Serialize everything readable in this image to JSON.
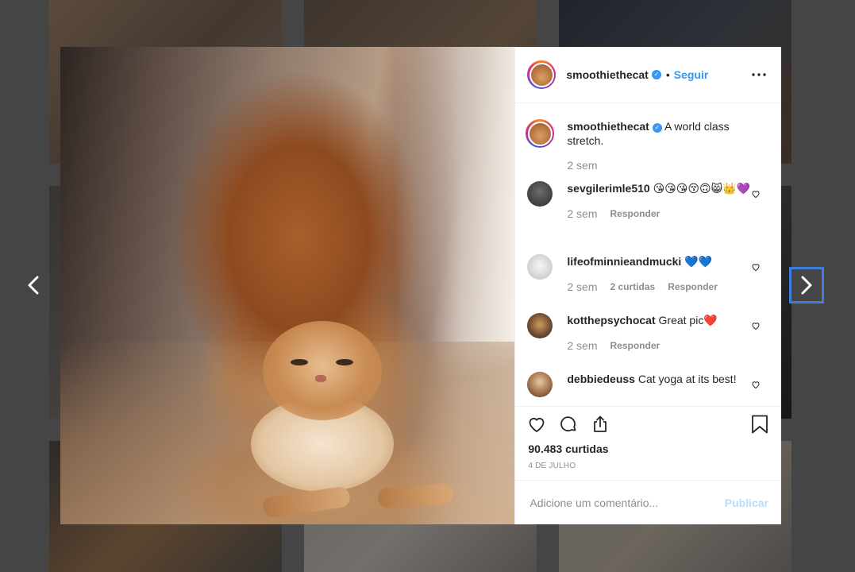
{
  "post": {
    "username": "smoothiethecat",
    "follow_label": "Seguir",
    "separator": "•",
    "caption": {
      "username": "smoothiethecat",
      "text": "A world class stretch.",
      "time": "2 sem"
    },
    "comments": [
      {
        "username": "sevgilerimle510",
        "text": "😘😘😘😚🙃😸👑💜",
        "time": "2 sem",
        "likes": "",
        "reply_label": "Responder"
      },
      {
        "username": "lifeofminnieandmucki",
        "text": "💙💙",
        "time": "2 sem",
        "likes": "2 curtidas",
        "reply_label": "Responder"
      },
      {
        "username": "kotthepsychocat",
        "text": "Great pic❤️",
        "time": "2 sem",
        "likes": "",
        "reply_label": "Responder"
      },
      {
        "username": "debbiedeuss",
        "text": "Cat yoga at its best!",
        "time": "",
        "likes": "",
        "reply_label": ""
      }
    ],
    "likes_count": "90.483 curtidas",
    "date": "4 DE JULHO",
    "comment_placeholder": "Adicione um comentário...",
    "publish_label": "Publicar"
  },
  "colors": {
    "accent": "#3897f0",
    "publish_disabled": "#b2dffc",
    "text": "#262626",
    "muted": "#8e8e8e",
    "nav_focus": "#3d7edb"
  },
  "icons": {
    "prev": "chevron-left-icon",
    "next": "chevron-right-icon",
    "more": "more-options-icon",
    "verified": "verified-badge-icon",
    "heart": "heart-icon",
    "comment": "comment-icon",
    "share": "share-icon",
    "save": "bookmark-icon"
  }
}
